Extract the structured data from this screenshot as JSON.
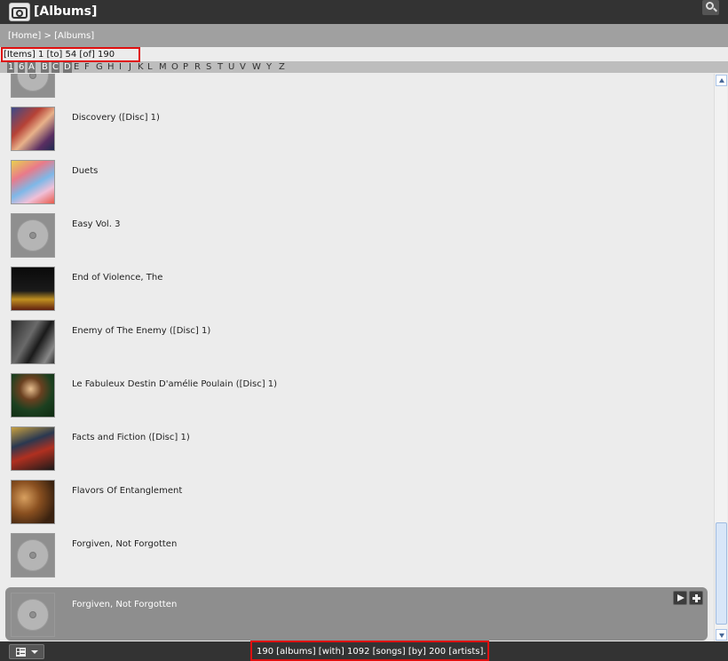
{
  "app": {
    "title": "[Albums]"
  },
  "breadcrumb": "[Home] > [Albums]",
  "items_count": "[Items] 1 [to] 54 [of] 190",
  "letters": [
    "1",
    "6",
    "A",
    "B",
    "C",
    "D",
    "E",
    "F",
    "G",
    "H",
    "I",
    "J",
    "K",
    "L",
    "M",
    "O",
    "P",
    "R",
    "S",
    "T",
    "U",
    "V",
    "W",
    "Y",
    "Z"
  ],
  "albums": [
    {
      "title": "",
      "art": "disc"
    },
    {
      "title": "Discovery ([Disc] 1)",
      "art": "anime"
    },
    {
      "title": "Duets",
      "art": "duets"
    },
    {
      "title": "Easy Vol. 3",
      "art": "disc"
    },
    {
      "title": "End of Violence, The",
      "art": "violence"
    },
    {
      "title": "Enemy of The Enemy ([Disc] 1)",
      "art": "enemy"
    },
    {
      "title": "Le Fabuleux Destin D'amélie Poulain ([Disc] 1)",
      "art": "amelie"
    },
    {
      "title": "Facts and Fiction ([Disc] 1)",
      "art": "facts"
    },
    {
      "title": "Flavors Of Entanglement",
      "art": "flavors"
    },
    {
      "title": "Forgiven, Not Forgotten",
      "art": "disc"
    },
    {
      "title": "Forgiven, Not Forgotten",
      "art": "disc"
    }
  ],
  "footer": {
    "status": "190 [albums] [with] 1092 [songs] [by] 200 [artists]."
  },
  "colors": {
    "titlebar": "#333333",
    "breadcrumb_bar": "#a0a0a0",
    "selected_row": "#8e8e8e",
    "highlight": "#e01010"
  }
}
